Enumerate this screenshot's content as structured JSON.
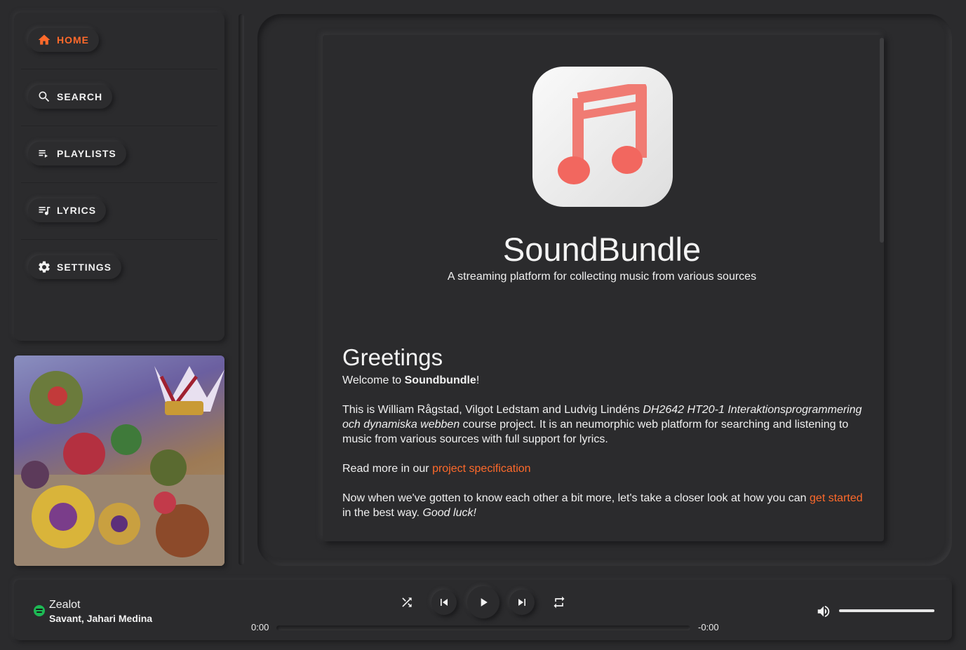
{
  "sidebar": {
    "items": [
      {
        "label": "HOME",
        "icon": "home-icon",
        "active": true
      },
      {
        "label": "SEARCH",
        "icon": "search-icon",
        "active": false
      },
      {
        "label": "PLAYLISTS",
        "icon": "playlist-icon",
        "active": false
      },
      {
        "label": "LYRICS",
        "icon": "lyrics-icon",
        "active": false
      },
      {
        "label": "SETTINGS",
        "icon": "gear-icon",
        "active": false
      }
    ]
  },
  "album": {
    "icon": "album-art-image"
  },
  "main": {
    "app_title": "SoundBundle",
    "app_subtitle": "A streaming platform for collecting music from various sources",
    "greeting_heading": "Greetings",
    "welcome_prefix": "Welcome to ",
    "welcome_brand": "Soundbundle",
    "welcome_suffix": "!",
    "intro_prefix": "This is William Rågstad, Vilgot Ledstam and Ludvig Lindéns ",
    "intro_course": "DH2642 HT20-1 Interaktionsprogrammering och dynamiska webben",
    "intro_suffix": " course project. It is an neumorphic web platform for searching and listening to music from various sources with full support for lyrics.",
    "readmore_prefix": "Read more in our ",
    "readmore_link": "project specification",
    "closing_prefix": "Now when we've gotten to know each other a bit more, let's take a closer look at how you can ",
    "closing_link": "get started",
    "closing_middle": " in the best way. ",
    "closing_italic": "Good luck!"
  },
  "player": {
    "track_title": "Zealot",
    "track_artist": "Savant, Jahari Medina",
    "source_icon": "spotify-icon",
    "time_elapsed": "0:00",
    "time_remaining": "-0:00",
    "progress": 0,
    "volume": 1.0
  },
  "colors": {
    "accent": "#ff6a2b",
    "background": "#2b2b2d",
    "text": "#f2f2f2",
    "spotify": "#1db954"
  }
}
